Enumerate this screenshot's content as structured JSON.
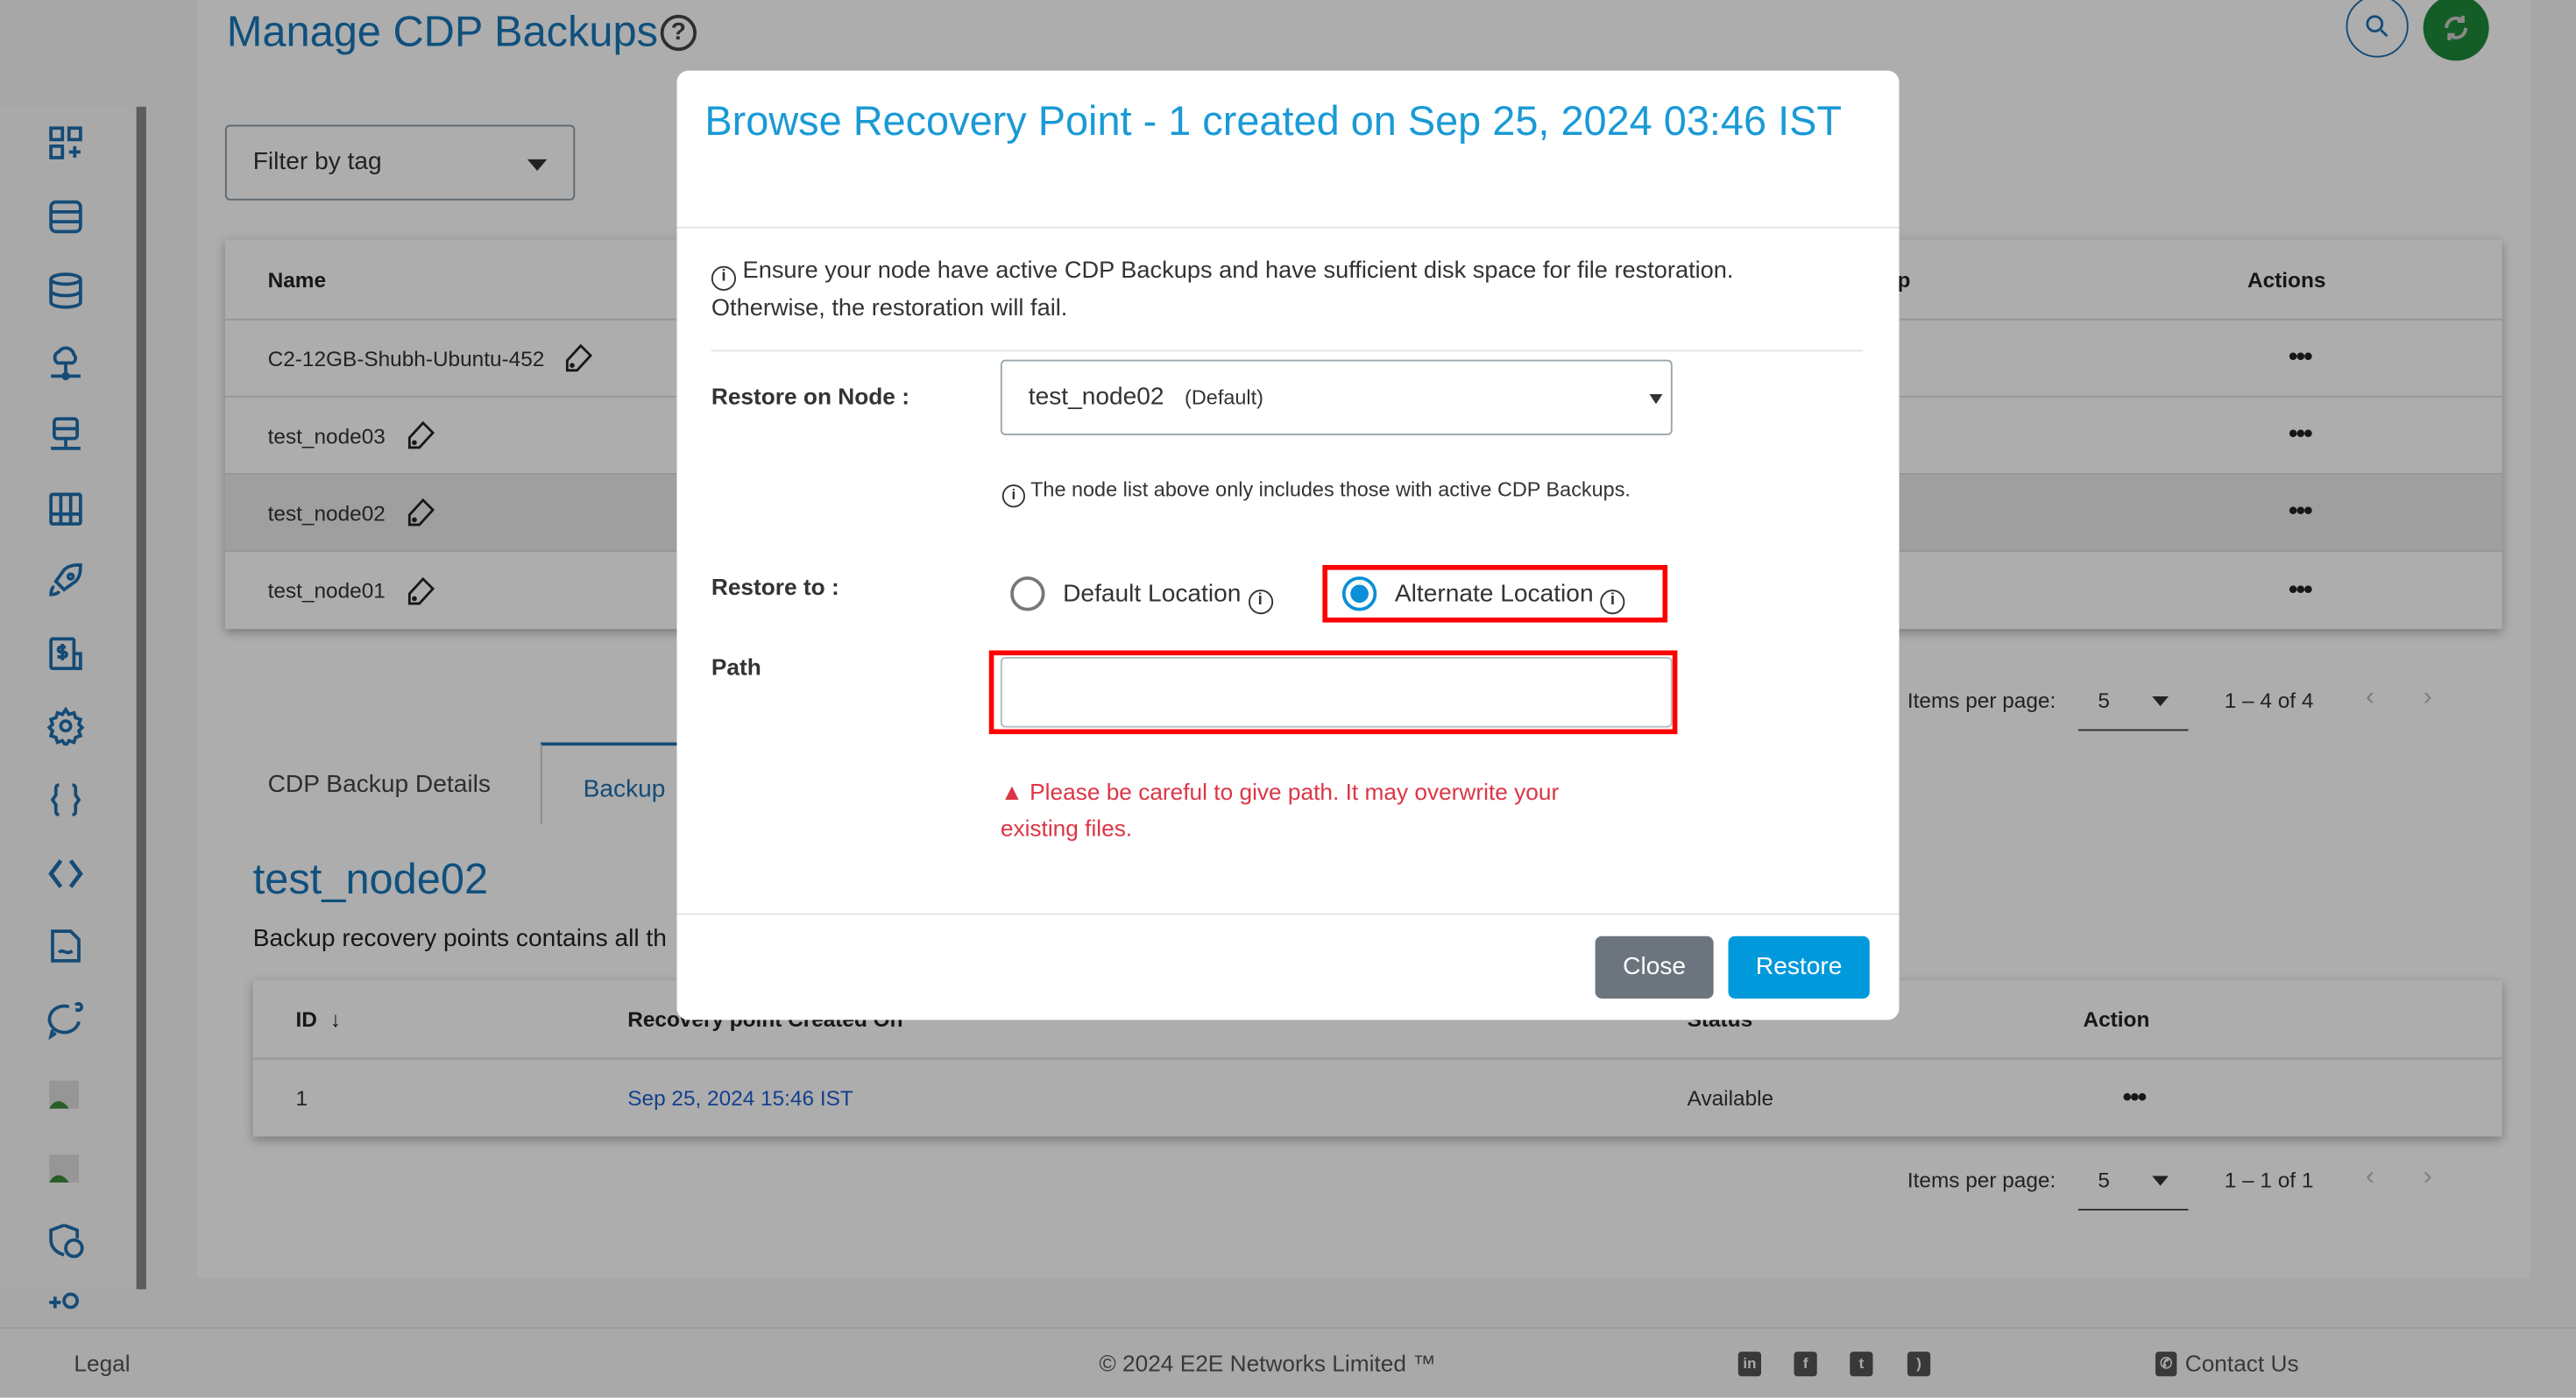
{
  "page": {
    "title": "Manage CDP Backups",
    "filter_placeholder": "Filter by tag"
  },
  "nodes_table": {
    "headers": {
      "name": "Name",
      "backup_partial": "up",
      "actions": "Actions"
    },
    "rows": [
      {
        "name": "C2-12GB-Shubh-Ubuntu-452"
      },
      {
        "name": "test_node03"
      },
      {
        "name": "test_node02",
        "selected": true
      },
      {
        "name": "test_node01"
      }
    ],
    "paginator": {
      "label": "Items per page:",
      "size": "5",
      "range": "1 – 4 of 4"
    }
  },
  "tabs": [
    {
      "label": "CDP Backup Details"
    },
    {
      "label": "Backup",
      "active": true
    }
  ],
  "detail": {
    "heading": "test_node02",
    "description": "Backup recovery points contains all th"
  },
  "recovery_table": {
    "headers": {
      "id": "ID",
      "created": "Recovery point Created On",
      "status": "Status",
      "action": "Action"
    },
    "rows": [
      {
        "id": "1",
        "created": "Sep 25, 2024 15:46 IST",
        "status": "Available"
      }
    ],
    "paginator": {
      "label": "Items per page:",
      "size": "5",
      "range": "1 – 1 of 1"
    }
  },
  "modal": {
    "title": "Browse Recovery Point - 1 created on Sep 25, 2024 03:46 IST",
    "info": "Ensure your node have active CDP Backups and have sufficient disk space for file restoration. Otherwise, the restoration will fail.",
    "restore_on_node_label": "Restore on Node :",
    "node_value": "test_node02",
    "node_suffix": "(Default)",
    "node_note": "The node list above only includes those with active CDP Backups.",
    "restore_to_label": "Restore to :",
    "options": [
      {
        "label": "Default Location",
        "selected": false
      },
      {
        "label": "Alternate Location",
        "selected": true
      }
    ],
    "path_label": "Path",
    "path_value": "",
    "warning": "Please be careful to give path. It may overwrite your existing files.",
    "close_label": "Close",
    "restore_label": "Restore"
  },
  "footer": {
    "legal": "Legal",
    "copyright": "© 2024 E2E Networks Limited ™",
    "contact": "Contact Us",
    "social": [
      "linkedin-icon",
      "facebook-icon",
      "twitter-icon",
      "rss-icon"
    ]
  },
  "colors": {
    "accent": "#1a9ad6",
    "brand": "#1f6fae",
    "refresh": "#1e8a3a",
    "warning": "#dc3545",
    "highlight": "#ff0000"
  }
}
